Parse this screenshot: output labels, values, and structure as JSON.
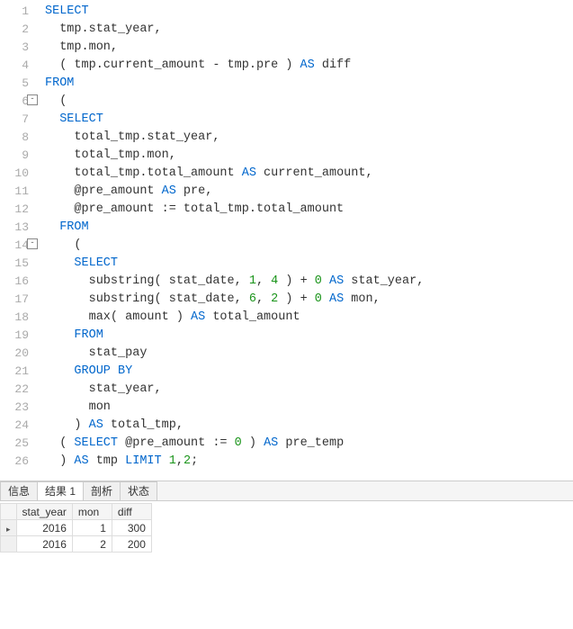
{
  "editor": {
    "lines": [
      {
        "n": 1,
        "fold": "",
        "tokens": [
          [
            "kw",
            "SELECT"
          ]
        ]
      },
      {
        "n": 2,
        "fold": "",
        "tokens": [
          [
            "id",
            "  tmp.stat_year,"
          ]
        ]
      },
      {
        "n": 3,
        "fold": "",
        "tokens": [
          [
            "id",
            "  tmp.mon,"
          ]
        ]
      },
      {
        "n": 4,
        "fold": "",
        "tokens": [
          [
            "id",
            "  ( tmp.current_amount - tmp.pre ) "
          ],
          [
            "kw",
            "AS"
          ],
          [
            "id",
            " diff"
          ]
        ]
      },
      {
        "n": 5,
        "fold": "",
        "tokens": [
          [
            "kw",
            "FROM"
          ]
        ]
      },
      {
        "n": 6,
        "fold": "-",
        "tokens": [
          [
            "id",
            "  ("
          ]
        ]
      },
      {
        "n": 7,
        "fold": "",
        "tokens": [
          [
            "id",
            "  "
          ],
          [
            "kw",
            "SELECT"
          ]
        ]
      },
      {
        "n": 8,
        "fold": "",
        "tokens": [
          [
            "id",
            "    total_tmp.stat_year,"
          ]
        ]
      },
      {
        "n": 9,
        "fold": "",
        "tokens": [
          [
            "id",
            "    total_tmp.mon,"
          ]
        ]
      },
      {
        "n": 10,
        "fold": "",
        "tokens": [
          [
            "id",
            "    total_tmp.total_amount "
          ],
          [
            "kw",
            "AS"
          ],
          [
            "id",
            " current_amount,"
          ]
        ]
      },
      {
        "n": 11,
        "fold": "",
        "tokens": [
          [
            "id",
            "    @pre_amount "
          ],
          [
            "kw",
            "AS"
          ],
          [
            "id",
            " pre,"
          ]
        ]
      },
      {
        "n": 12,
        "fold": "",
        "tokens": [
          [
            "id",
            "    @pre_amount := total_tmp.total_amount"
          ]
        ]
      },
      {
        "n": 13,
        "fold": "",
        "tokens": [
          [
            "id",
            "  "
          ],
          [
            "kw",
            "FROM"
          ]
        ]
      },
      {
        "n": 14,
        "fold": "-",
        "tokens": [
          [
            "id",
            "    ("
          ]
        ]
      },
      {
        "n": 15,
        "fold": "",
        "tokens": [
          [
            "id",
            "    "
          ],
          [
            "kw",
            "SELECT"
          ]
        ]
      },
      {
        "n": 16,
        "fold": "",
        "tokens": [
          [
            "id",
            "      substring( stat_date, "
          ],
          [
            "num",
            "1"
          ],
          [
            "id",
            ", "
          ],
          [
            "num",
            "4"
          ],
          [
            "id",
            " ) + "
          ],
          [
            "num",
            "0"
          ],
          [
            "id",
            " "
          ],
          [
            "kw",
            "AS"
          ],
          [
            "id",
            " stat_year,"
          ]
        ]
      },
      {
        "n": 17,
        "fold": "",
        "tokens": [
          [
            "id",
            "      substring( stat_date, "
          ],
          [
            "num",
            "6"
          ],
          [
            "id",
            ", "
          ],
          [
            "num",
            "2"
          ],
          [
            "id",
            " ) + "
          ],
          [
            "num",
            "0"
          ],
          [
            "id",
            " "
          ],
          [
            "kw",
            "AS"
          ],
          [
            "id",
            " mon,"
          ]
        ]
      },
      {
        "n": 18,
        "fold": "",
        "tokens": [
          [
            "id",
            "      max( amount ) "
          ],
          [
            "kw",
            "AS"
          ],
          [
            "id",
            " total_amount"
          ]
        ]
      },
      {
        "n": 19,
        "fold": "",
        "tokens": [
          [
            "id",
            "    "
          ],
          [
            "kw",
            "FROM"
          ]
        ]
      },
      {
        "n": 20,
        "fold": "",
        "tokens": [
          [
            "id",
            "      stat_pay"
          ]
        ]
      },
      {
        "n": 21,
        "fold": "",
        "tokens": [
          [
            "id",
            "    "
          ],
          [
            "kw",
            "GROUP BY"
          ]
        ]
      },
      {
        "n": 22,
        "fold": "",
        "tokens": [
          [
            "id",
            "      stat_year,"
          ]
        ]
      },
      {
        "n": 23,
        "fold": "",
        "tokens": [
          [
            "id",
            "      mon "
          ]
        ]
      },
      {
        "n": 24,
        "fold": "",
        "tokens": [
          [
            "id",
            "    ) "
          ],
          [
            "kw",
            "AS"
          ],
          [
            "id",
            " total_tmp,"
          ]
        ]
      },
      {
        "n": 25,
        "fold": "",
        "tokens": [
          [
            "id",
            "  ( "
          ],
          [
            "kw",
            "SELECT"
          ],
          [
            "id",
            " @pre_amount := "
          ],
          [
            "num",
            "0"
          ],
          [
            "id",
            " ) "
          ],
          [
            "kw",
            "AS"
          ],
          [
            "id",
            " pre_temp "
          ]
        ]
      },
      {
        "n": 26,
        "fold": "",
        "tokens": [
          [
            "id",
            "  ) "
          ],
          [
            "kw",
            "AS"
          ],
          [
            "id",
            " tmp "
          ],
          [
            "kw",
            "LIMIT"
          ],
          [
            "id",
            " "
          ],
          [
            "num",
            "1"
          ],
          [
            "id",
            ","
          ],
          [
            "num",
            "2"
          ],
          [
            "id",
            ";"
          ]
        ]
      }
    ]
  },
  "results": {
    "tabs": [
      {
        "label": "信息",
        "active": false
      },
      {
        "label": "结果 1",
        "active": true
      },
      {
        "label": "剖析",
        "active": false
      },
      {
        "label": "状态",
        "active": false
      }
    ],
    "columns": [
      "stat_year",
      "mon",
      "diff"
    ],
    "rows": [
      {
        "active": true,
        "cells": [
          "2016",
          "1",
          "300"
        ]
      },
      {
        "active": false,
        "cells": [
          "2016",
          "2",
          "200"
        ]
      }
    ]
  }
}
